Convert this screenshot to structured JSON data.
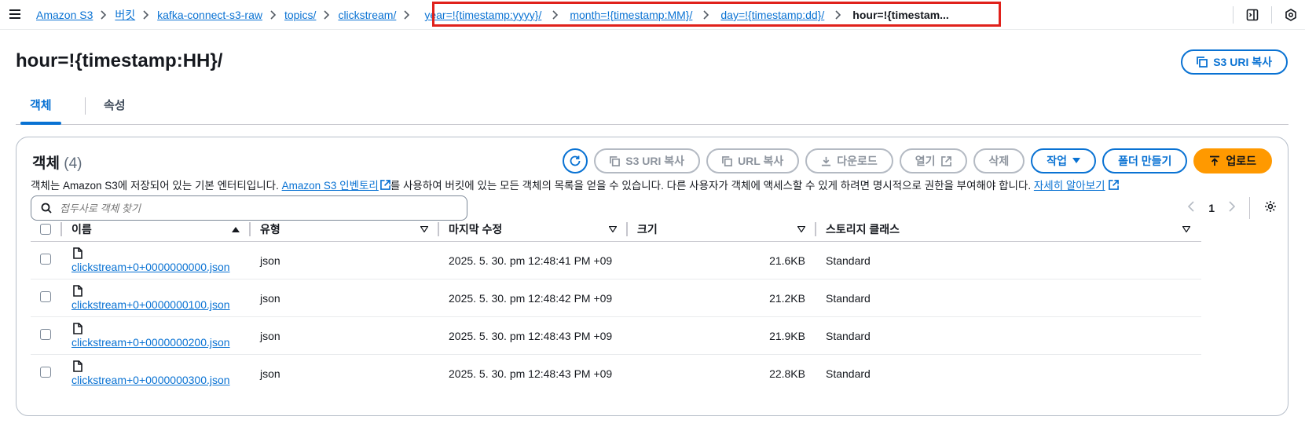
{
  "breadcrumbs": [
    {
      "label": "Amazon S3"
    },
    {
      "label": "버킷"
    },
    {
      "label": "kafka-connect-s3-raw"
    },
    {
      "label": "topics/"
    },
    {
      "label": "clickstream/"
    },
    {
      "label": "year=!{timestamp:yyyy}/"
    },
    {
      "label": "month=!{timestamp:MM}/"
    },
    {
      "label": "day=!{timestamp:dd}/"
    },
    {
      "label": "hour=!{timestam..."
    }
  ],
  "page": {
    "title": "hour=!{timestamp:HH}/",
    "copy_uri_label": "S3 URI 복사"
  },
  "tabs": [
    {
      "label": "객체"
    },
    {
      "label": "속성"
    }
  ],
  "objects": {
    "title": "객체",
    "count": "(4)",
    "actions": {
      "copy_s3_uri": "S3 URI 복사",
      "copy_url": "URL 복사",
      "download": "다운로드",
      "open": "열기",
      "delete": "삭제",
      "actions_menu": "작업",
      "create_folder": "폴더 만들기",
      "upload": "업로드"
    },
    "description": {
      "part1": "객체는 Amazon S3에 저장되어 있는 기본 엔터티입니다. ",
      "link1": "Amazon S3 인벤토리",
      "part2": "를 사용하여 버킷에 있는 모든 객체의 목록을 얻을 수 있습니다. 다른 사용자가 객체에 액세스할 수 있게 하려면 명시적으로 권한을 부여해야 합니다. ",
      "link2": "자세히 알아보기"
    },
    "search_placeholder": "접두사로 객체 찾기",
    "page_number": "1",
    "columns": {
      "name": "이름",
      "type": "유형",
      "modified": "마지막 수정",
      "size": "크기",
      "storage": "스토리지 클래스"
    },
    "rows": [
      {
        "name": "clickstream+0+0000000000.json",
        "type": "json",
        "modified": "2025. 5. 30. pm 12:48:41 PM +09",
        "size": "21.6KB",
        "storage": "Standard"
      },
      {
        "name": "clickstream+0+0000000100.json",
        "type": "json",
        "modified": "2025. 5. 30. pm 12:48:42 PM +09",
        "size": "21.2KB",
        "storage": "Standard"
      },
      {
        "name": "clickstream+0+0000000200.json",
        "type": "json",
        "modified": "2025. 5. 30. pm 12:48:43 PM +09",
        "size": "21.9KB",
        "storage": "Standard"
      },
      {
        "name": "clickstream+0+0000000300.json",
        "type": "json",
        "modified": "2025. 5. 30. pm 12:48:43 PM +09",
        "size": "22.8KB",
        "storage": "Standard"
      }
    ]
  },
  "colors": {
    "link": "#0972d3",
    "highlight": "#e0211b",
    "upload": "#ff9900"
  }
}
